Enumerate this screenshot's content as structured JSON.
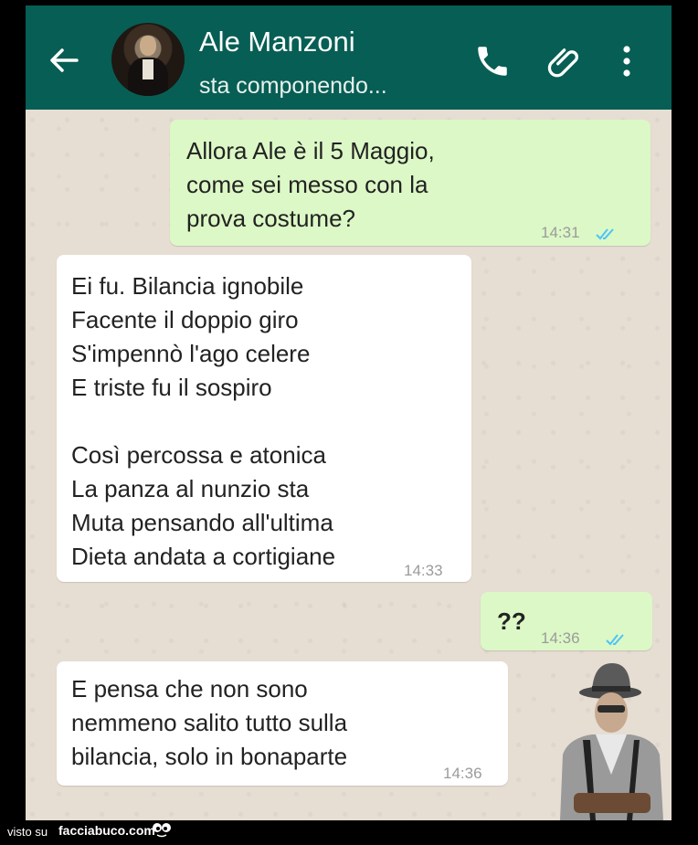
{
  "header": {
    "contact_name": "Ale Manzoni",
    "status": "sta componendo...",
    "icons": [
      "back-arrow-icon",
      "phone-icon",
      "paperclip-icon",
      "more-vert-icon"
    ],
    "background_color": "#075e54"
  },
  "messages": [
    {
      "direction": "outgoing",
      "text": "Allora Ale è il 5 Maggio,\ncome sei messo con la\nprova costume?",
      "time": "14:31",
      "status": "read"
    },
    {
      "direction": "incoming",
      "text": "Ei fu. Bilancia ignobile\nFacente il doppio giro\nS'impennò l'ago celere\nE triste fu il sospiro\n\nCosì percossa e atonica\nLa panza al nunzio sta\nMuta pensando all'ultima\nDieta andata a cortigiane",
      "time": "14:33"
    },
    {
      "direction": "outgoing",
      "text": "??",
      "time": "14:36",
      "status": "read"
    },
    {
      "direction": "incoming",
      "text": "E pensa che non sono\nnemmeno salito tutto sulla\nbilancia, solo in bonaparte",
      "time": "14:36"
    }
  ],
  "colors": {
    "outgoing_bubble": "#dcf8c6",
    "incoming_bubble": "#ffffff",
    "chat_background": "#e6ddd3",
    "read_ticks": "#4fc3f7"
  },
  "footer": {
    "visto_su": "visto su",
    "brand": "facciabuco.com"
  }
}
